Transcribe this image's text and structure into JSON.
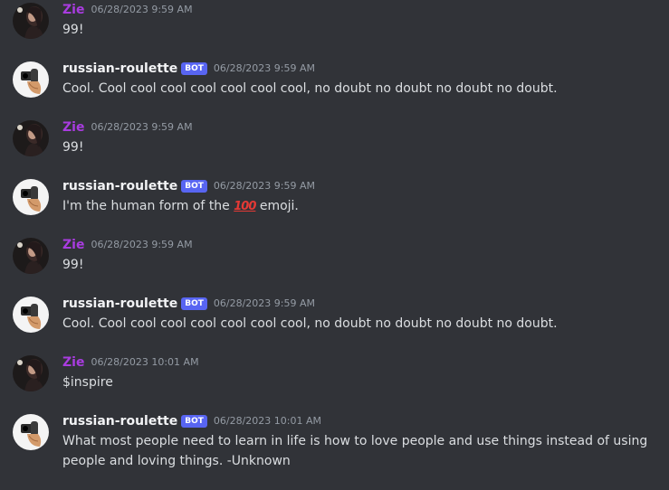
{
  "messages": [
    {
      "author": "Zie",
      "author_type": "user",
      "author_color": "#a93ce0",
      "avatar_icon": "zie-avatar-icon",
      "timestamp": "06/28/2023 9:59 AM",
      "text": "99!"
    },
    {
      "author": "russian-roulette",
      "author_type": "bot",
      "badge": "BOT",
      "avatar_icon": "revolver-hand-icon",
      "timestamp": "06/28/2023 9:59 AM",
      "text": "Cool. Cool cool cool cool cool cool cool, no doubt no doubt no doubt no doubt."
    },
    {
      "author": "Zie",
      "author_type": "user",
      "author_color": "#a93ce0",
      "avatar_icon": "zie-avatar-icon",
      "timestamp": "06/28/2023 9:59 AM",
      "text": "99!"
    },
    {
      "author": "russian-roulette",
      "author_type": "bot",
      "badge": "BOT",
      "avatar_icon": "revolver-hand-icon",
      "timestamp": "06/28/2023 9:59 AM",
      "text_before": "I'm the human form of the ",
      "emoji": "100",
      "emoji_icon": "hundred-points-emoji",
      "text_after": " emoji."
    },
    {
      "author": "Zie",
      "author_type": "user",
      "author_color": "#a93ce0",
      "avatar_icon": "zie-avatar-icon",
      "timestamp": "06/28/2023 9:59 AM",
      "text": "99!"
    },
    {
      "author": "russian-roulette",
      "author_type": "bot",
      "badge": "BOT",
      "avatar_icon": "revolver-hand-icon",
      "timestamp": "06/28/2023 9:59 AM",
      "text": "Cool. Cool cool cool cool cool cool cool, no doubt no doubt no doubt no doubt."
    },
    {
      "author": "Zie",
      "author_type": "user",
      "author_color": "#a93ce0",
      "avatar_icon": "zie-avatar-icon",
      "timestamp": "06/28/2023 10:01 AM",
      "text": "$inspire"
    },
    {
      "author": "russian-roulette",
      "author_type": "bot",
      "badge": "BOT",
      "avatar_icon": "revolver-hand-icon",
      "timestamp": "06/28/2023 10:01 AM",
      "text": "What most people need to learn in life is how to love people and use things instead of using people and loving things. -Unknown"
    }
  ],
  "colors": {
    "background": "#313338",
    "message_text": "#dbdee1",
    "timestamp": "#949ba4",
    "bot_badge": "#5865f2",
    "user_name": "#a93ce0"
  }
}
